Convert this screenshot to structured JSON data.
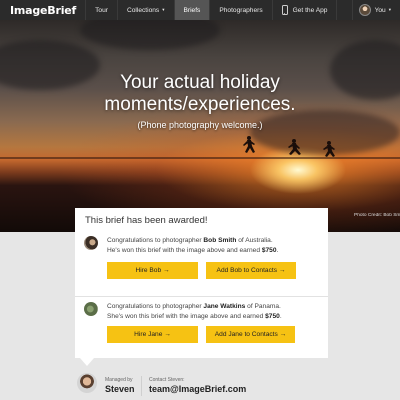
{
  "nav": {
    "logo": "ImageBrief",
    "items": [
      {
        "label": "Tour"
      },
      {
        "label": "Collections",
        "caret": "▾"
      },
      {
        "label": "Briefs"
      },
      {
        "label": "Photographers"
      },
      {
        "label": "Get the App",
        "icon": "phone-icon"
      }
    ],
    "user_label": "You",
    "user_caret": "▾"
  },
  "hero": {
    "title_line1": "Your actual holiday",
    "title_line2": "moments/experiences.",
    "subtitle": "(Phone photography welcome.)",
    "credit": "Photo Credit: Bob Smith"
  },
  "award": {
    "heading": "This brief has been awarded!",
    "winners": [
      {
        "prefix": "Congratulations to photographer ",
        "name": "Bob Smith",
        "of": " of Australia.",
        "line2": "He's won this brief with the image above and earned ",
        "amount": "$750",
        "end": ".",
        "hire_label": "Hire Bob →",
        "contact_label": "Add Bob to Contacts →"
      },
      {
        "prefix": "Congratulations to photographer ",
        "name": "Jane Watkins",
        "of": " of Panama.",
        "line2": "She's won this brief with the image above and earned ",
        "amount": "$750",
        "end": ".",
        "hire_label": "Hire Jane →",
        "contact_label": "Add Jane to Contacts →"
      }
    ]
  },
  "manager": {
    "label": "Managed by",
    "name": "Steven",
    "contact_label": "Contact Steven:",
    "email": "team@ImageBrief.com"
  },
  "colors": {
    "nav_bg": "#2b2b2b",
    "accent": "#f6c213",
    "page_bg": "#e6e6e6"
  }
}
